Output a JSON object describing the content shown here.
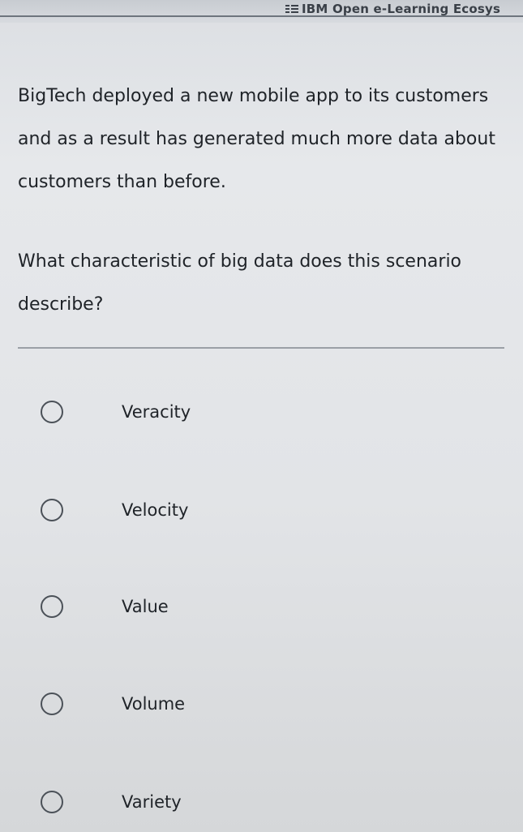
{
  "header": {
    "brand_text": "IBM Open e-Learning Ecosys"
  },
  "question": {
    "text": "BigTech deployed a new mobile app to its customers and as a result has generated much more data about customers than before.",
    "prompt": "What characteristic of big data does this scenario describe?"
  },
  "options": [
    {
      "label": "Veracity"
    },
    {
      "label": "Velocity"
    },
    {
      "label": "Value"
    },
    {
      "label": "Volume"
    },
    {
      "label": "Variety"
    }
  ],
  "colors": {
    "background": "#e4e6e9",
    "text": "#1f2328",
    "radio_border": "#4b5158",
    "divider": "#9aa0a6"
  }
}
